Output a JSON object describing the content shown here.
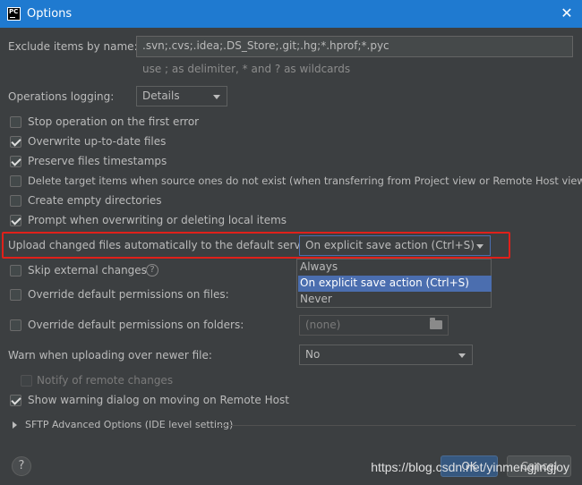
{
  "window": {
    "title": "Options",
    "app_icon": "pycharm-icon",
    "app_icon_text": "PC"
  },
  "exclude": {
    "label": "Exclude items by name:",
    "value": ".svn;.cvs;.idea;.DS_Store;.git;.hg;*.hprof;*.pyc",
    "hint": "use ; as delimiter, * and ? as wildcards"
  },
  "operations_logging": {
    "label": "Operations logging:",
    "value": "Details"
  },
  "checkboxes": [
    {
      "label": "Stop operation on the first error",
      "checked": false
    },
    {
      "label": "Overwrite up-to-date files",
      "checked": true
    },
    {
      "label": "Preserve files timestamps",
      "checked": true
    },
    {
      "label": "Delete target items when source ones do not exist (when transferring from Project view or Remote Host view)",
      "checked": false
    },
    {
      "label": "Create empty directories",
      "checked": false
    },
    {
      "label": "Prompt when overwriting or deleting local items",
      "checked": true
    }
  ],
  "upload": {
    "label": "Upload changed files automatically to the default server",
    "value": "On explicit save action (Ctrl+S)",
    "options": [
      "Always",
      "On explicit save action (Ctrl+S)",
      "Never"
    ],
    "selected_index": 1
  },
  "skip_external": {
    "label": "Skip external changes",
    "checked": false
  },
  "override_files": {
    "label": "Override default permissions on files:",
    "checked": false
  },
  "override_folders": {
    "label": "Override default permissions on folders:",
    "checked": false,
    "value": "(none)"
  },
  "warn_upload": {
    "label": "Warn when uploading over newer file:",
    "value": "No"
  },
  "notify_remote": {
    "label": "Notify of remote changes",
    "checked": false
  },
  "show_warning": {
    "label": "Show warning dialog on moving on Remote Host",
    "checked": true
  },
  "sftp": {
    "label": "SFTP Advanced Options (IDE level setting)"
  },
  "footer": {
    "help_label": "?",
    "ok_label": "OK",
    "cancel_label": "Cancel",
    "watermark": "https://blog.csdn.net/yinmengjingjoy"
  },
  "colors": {
    "titlebar": "#1f7ad0",
    "background": "#3c3f41",
    "highlight": "#e0201a",
    "selection": "#4b6eaf"
  }
}
